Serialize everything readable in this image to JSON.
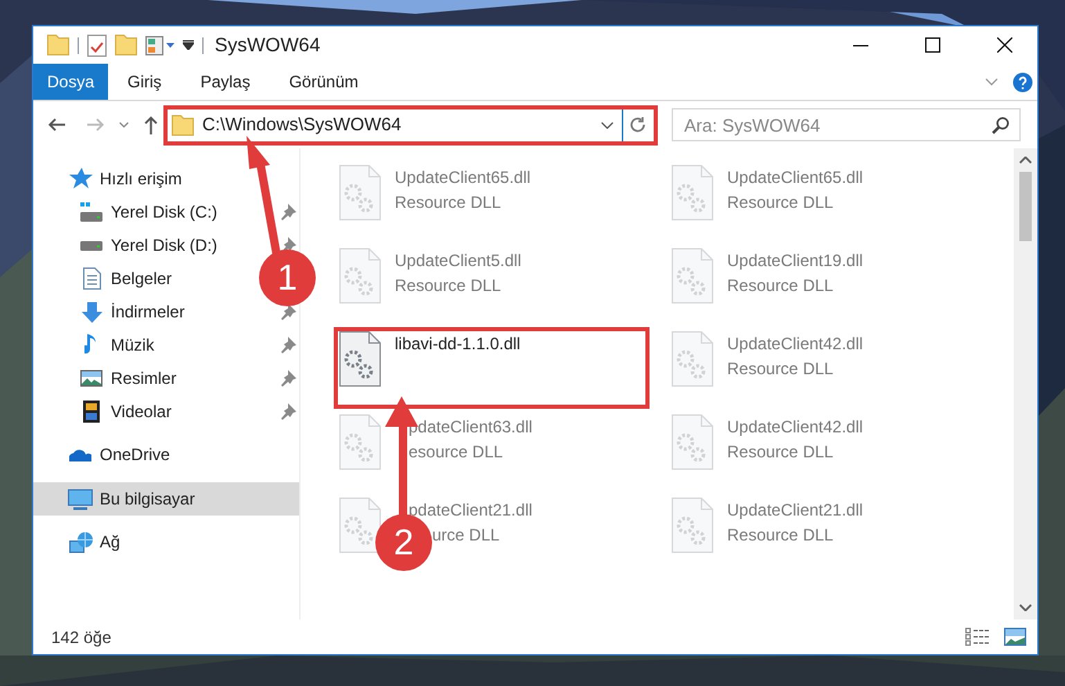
{
  "window": {
    "title": "SysWOW64"
  },
  "ribbon_tabs": [
    {
      "label": "Dosya",
      "kind": "file"
    },
    {
      "label": "Giriş",
      "kind": "tab"
    },
    {
      "label": "Paylaş",
      "kind": "tab"
    },
    {
      "label": "Görünüm",
      "kind": "tab"
    }
  ],
  "address": {
    "path": "C:\\Windows\\SysWOW64",
    "highlighted": true
  },
  "search": {
    "placeholder": "Ara: SysWOW64"
  },
  "navigation": [
    {
      "label": "Hızlı erişim",
      "selected": false,
      "children": [
        {
          "label": "Yerel Disk (C:)",
          "pinned": true
        },
        {
          "label": "Yerel Disk (D:)",
          "pinned": true
        },
        {
          "label": "Belgeler"
        },
        {
          "label": "İndirmeler",
          "pinned": true
        },
        {
          "label": "Müzik",
          "pinned": true
        },
        {
          "label": "Resimler",
          "pinned": true
        },
        {
          "label": "Videolar",
          "pinned": true
        }
      ]
    },
    {
      "label": "OneDrive",
      "selected": false
    },
    {
      "label": "Bu bilgisayar",
      "selected": true
    },
    {
      "label": "Ağ",
      "selected": false
    }
  ],
  "files": [
    {
      "name": "UpdateClient65.dll",
      "type": "Resource DLL",
      "blurred": true,
      "highlighted": false
    },
    {
      "name": "UpdateClient65.dll",
      "type": "Resource DLL",
      "blurred": true,
      "highlighted": false
    },
    {
      "name": "UpdateClient5.dll",
      "type": "Resource DLL",
      "blurred": true,
      "highlighted": false
    },
    {
      "name": "UpdateClient19.dll",
      "type": "Resource DLL",
      "blurred": true,
      "highlighted": false
    },
    {
      "name": "libavi-dd-1.1.0.dll",
      "blurred": false,
      "highlighted": true
    },
    {
      "name": "UpdateClient42.dll",
      "type": "Resource DLL",
      "blurred": true,
      "highlighted": false
    },
    {
      "name": "pdateClient63.dll",
      "type": "esource DLL",
      "blurred": true,
      "highlighted": false,
      "kind": "under-arrow"
    },
    {
      "name": "UpdateClient42.dll",
      "type": "Resource DLL",
      "blurred": true,
      "highlighted": false
    },
    {
      "name": "pdateClient21.dll",
      "type": "urce DLL",
      "blurred": true,
      "highlighted": false,
      "kind": "under-badge"
    },
    {
      "name": "UpdateClient21.dll",
      "type": "Resource DLL",
      "blurred": true,
      "highlighted": false
    }
  ],
  "status_bar": {
    "item_count": "142 öğe"
  },
  "annotations": [
    {
      "number": "1"
    },
    {
      "number": "2"
    }
  ]
}
